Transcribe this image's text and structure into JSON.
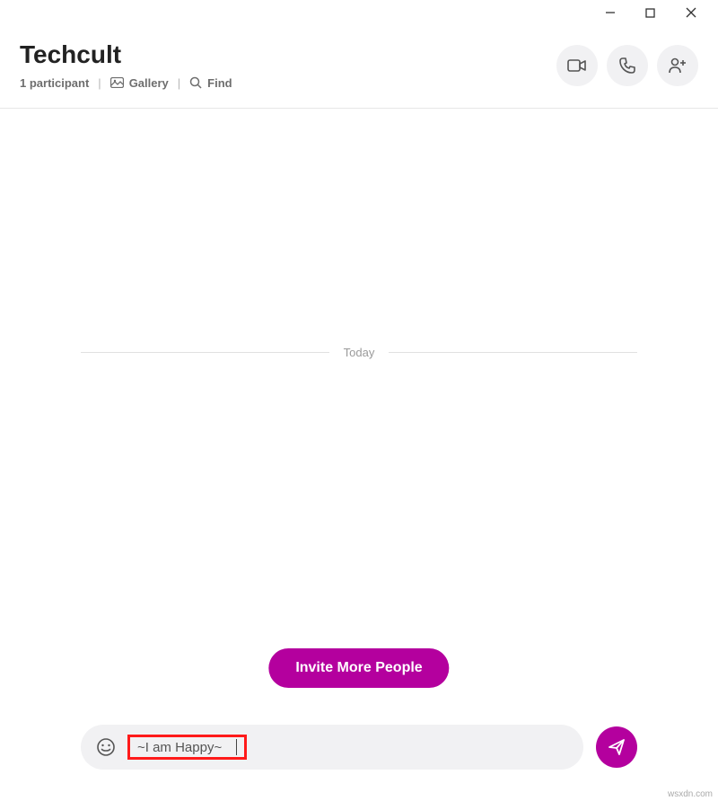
{
  "header": {
    "title": "Techcult",
    "participants_label": "1 participant",
    "gallery_label": "Gallery",
    "find_label": "Find"
  },
  "divider": {
    "label": "Today"
  },
  "invite": {
    "label": "Invite More People"
  },
  "composer": {
    "message_value": "~I am Happy~"
  },
  "colors": {
    "accent": "#b4009e",
    "highlight_border": "#ff1a1a",
    "icon_bg": "#f1f1f3"
  },
  "watermark": "wsxdn.com"
}
